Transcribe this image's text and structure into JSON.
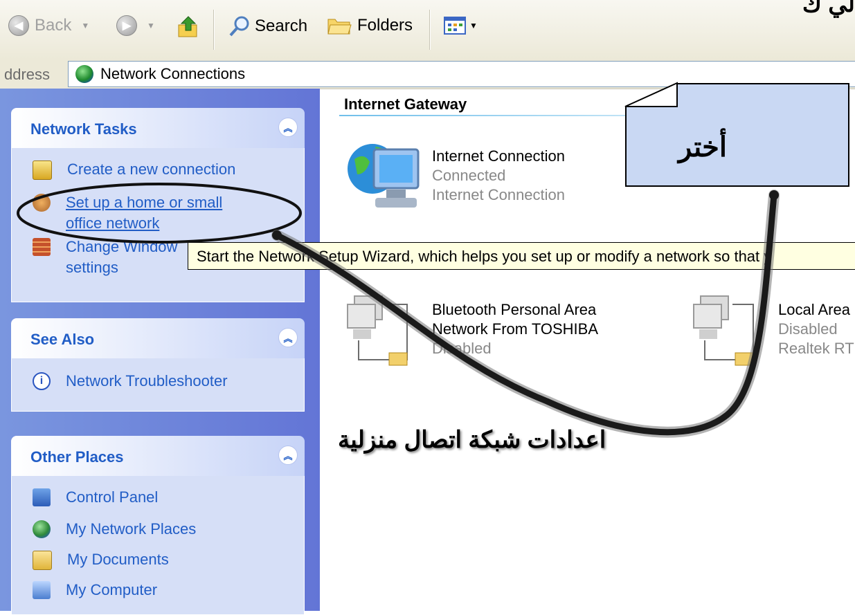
{
  "toolbar": {
    "back_label": "Back",
    "search_label": "Search",
    "folders_label": "Folders",
    "corner_text": "لي ك"
  },
  "address": {
    "label": "ddress",
    "value": "Network Connections"
  },
  "sidebar": {
    "network_tasks": {
      "title": "Network Tasks",
      "collapse_icon": "chevron-up-double-icon",
      "items": [
        {
          "line1": "Create a new connection",
          "icon": "new-connection-icon"
        },
        {
          "line1": "Set up a home or small",
          "line2": "office network",
          "icon": "home-network-icon"
        },
        {
          "line1": "Change Window",
          "line2": "settings",
          "icon": "firewall-icon"
        }
      ]
    },
    "see_also": {
      "title": "See Also",
      "items": [
        {
          "line1": "Network Troubleshooter",
          "icon": "info-icon"
        }
      ]
    },
    "other_places": {
      "title": "Other Places",
      "items": [
        {
          "line1": "Control Panel",
          "icon": "control-panel-icon"
        },
        {
          "line1": "My Network Places",
          "icon": "network-places-icon"
        },
        {
          "line1": "My Documents",
          "icon": "documents-icon"
        },
        {
          "line1": "My Computer",
          "icon": "computer-icon"
        }
      ]
    }
  },
  "main": {
    "group_title": "Internet Gateway",
    "internet_connection": {
      "name": "Internet Connection",
      "status": "Connected",
      "type": "Internet Connection"
    },
    "bluetooth": {
      "name_line1": "Bluetooth Personal Area",
      "name_line2": "Network From TOSHIBA",
      "status": "Disabled"
    },
    "local_area": {
      "name": "Local Area",
      "status": "Disabled",
      "adapter": "Realtek RT"
    }
  },
  "tooltip": "Start the Network Setup Wizard, which helps you set up or modify a network so that y",
  "annotations": {
    "callout": "أختر",
    "caption": "اعدادات شبكة اتصال منزلية"
  },
  "colors": {
    "sidebar_bg": "#6f85da",
    "link": "#215dc6",
    "tooltip_bg": "#ffffe1",
    "callout_bg": "#c9d8f3"
  }
}
